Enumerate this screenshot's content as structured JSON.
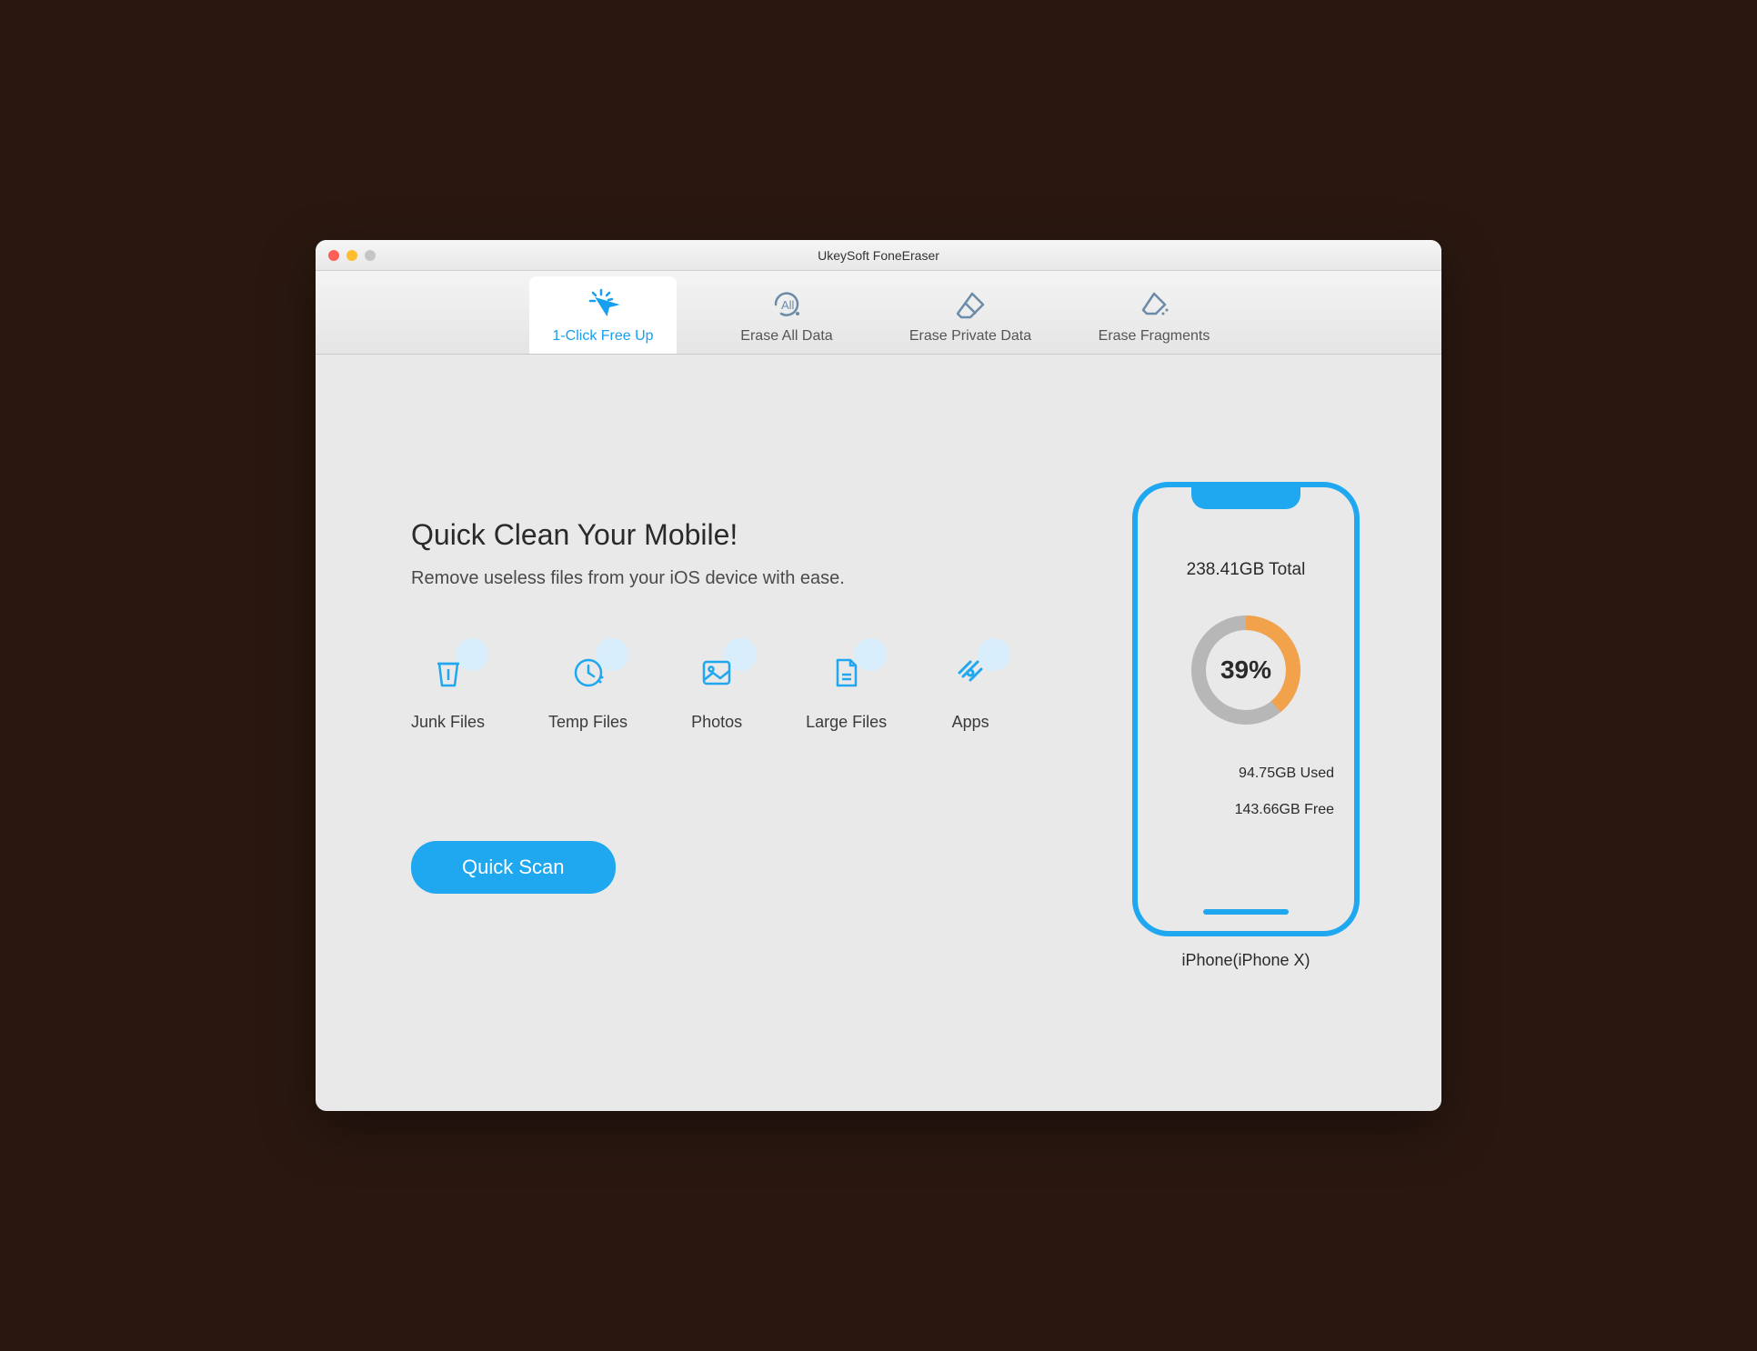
{
  "window": {
    "title": "UkeySoft FoneEraser"
  },
  "tabs": [
    {
      "label": "1-Click Free Up",
      "active": true
    },
    {
      "label": "Erase All Data",
      "active": false
    },
    {
      "label": "Erase Private Data",
      "active": false
    },
    {
      "label": "Erase Fragments",
      "active": false
    }
  ],
  "main": {
    "heading": "Quick Clean Your Mobile!",
    "subheading": "Remove useless files from your iOS device with ease.",
    "categories": [
      {
        "label": "Junk Files"
      },
      {
        "label": "Temp Files"
      },
      {
        "label": "Photos"
      },
      {
        "label": "Large Files"
      },
      {
        "label": "Apps"
      }
    ],
    "scan_button": "Quick Scan"
  },
  "device": {
    "total_label": "238.41GB Total",
    "used_percent": 39,
    "percent_label": "39%",
    "used_label": "94.75GB Used",
    "free_label": "143.66GB Free",
    "name": "iPhone(iPhone X)"
  },
  "colors": {
    "accent": "#1fa7ef",
    "donut_used": "#f2a24b",
    "donut_free": "#b7b7b7"
  },
  "chart_data": {
    "type": "pie",
    "title": "Storage Usage",
    "categories": [
      "Used",
      "Free"
    ],
    "values": [
      94.75,
      143.66
    ],
    "unit": "GB",
    "total": 238.41,
    "percent_used": 39
  }
}
